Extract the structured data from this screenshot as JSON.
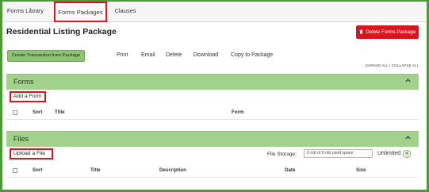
{
  "tabs": [
    {
      "label": "Forms Library"
    },
    {
      "label": "Forms Packages"
    },
    {
      "label": "Clauses"
    }
  ],
  "header": {
    "title": "Residential Listing Package",
    "delete_button": "Delete Forms Package"
  },
  "toolbar": {
    "create_button": "Create Transaction from Package",
    "actions": [
      "Print",
      "Email",
      "Delete",
      "Download",
      "Copy to Package"
    ],
    "expand_collapse": "EXPAND ALL / COLLAPSE ALL"
  },
  "forms_section": {
    "title": "Forms",
    "add_link": "Add a Form",
    "columns": [
      "Sort",
      "Title",
      "Form"
    ]
  },
  "files_section": {
    "title": "Files",
    "upload_link": "Upload a File",
    "storage_label": "File Storage:",
    "storage_value": "0 mb of 5 mb used space",
    "unlimited": "Unlimited",
    "columns": [
      "Sort",
      "Title",
      "Description",
      "Date",
      "Size"
    ]
  },
  "colors": {
    "accent_green": "#a1d18a",
    "button_green": "#8cc56f",
    "danger_red": "#d9161e",
    "frame_green": "#4a9b33"
  },
  "icons": [
    "trash-icon",
    "chevron-up-icon",
    "arrow-up-circle-icon",
    "checkbox-icon"
  ]
}
